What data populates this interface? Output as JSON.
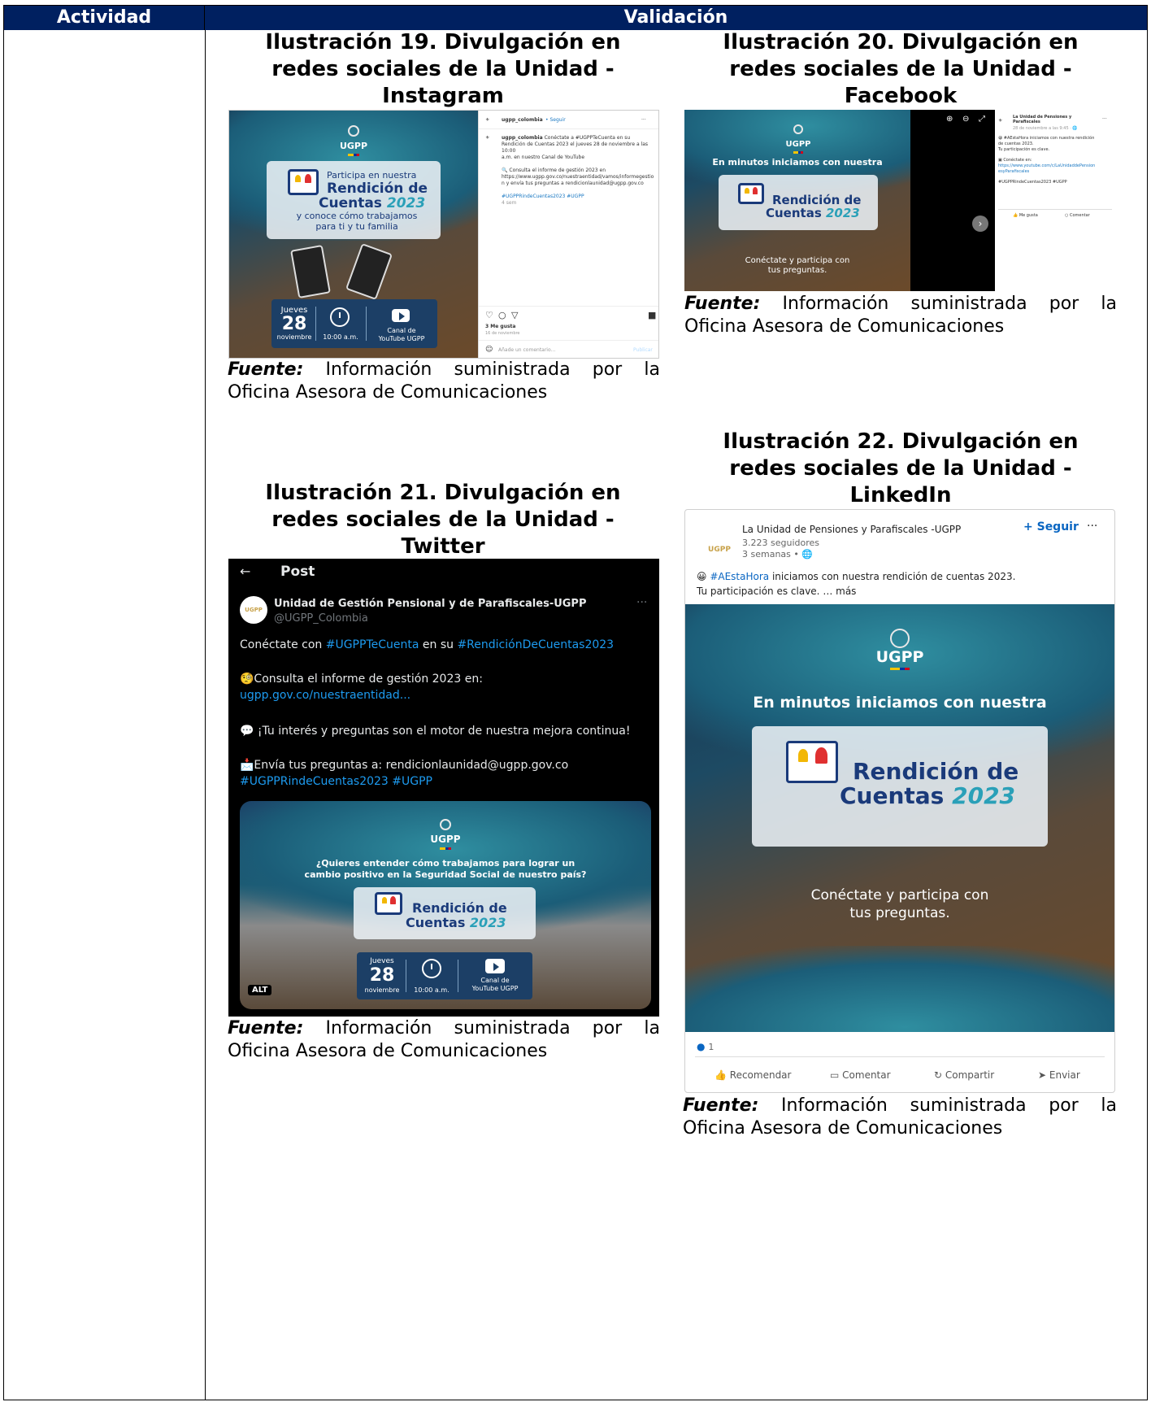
{
  "header": {
    "activity": "Actividad",
    "validation": "Validación"
  },
  "source": {
    "label": "Fuente:",
    "text": "Información suministrada por la Oficina Asesora de Comunicaciones",
    "w1": "Información",
    "w2": "suministrada",
    "w3": "por",
    "w4": "la",
    "line2": "Oficina Asesora de Comunicaciones"
  },
  "figures": [
    {
      "caption_l1": "Ilustración 19. Divulgación en",
      "caption_l2": "redes sociales de la Unidad -",
      "caption_l3": "Instagram"
    },
    {
      "caption_l1": "Ilustración 20. Divulgación en",
      "caption_l2": "redes sociales de la Unidad -",
      "caption_l3": "Facebook"
    },
    {
      "caption_l1": "Ilustración 21. Divulgación en",
      "caption_l2": "redes sociales de la Unidad -",
      "caption_l3": "Twitter"
    },
    {
      "caption_l1": "Ilustración 22. Divulgación en",
      "caption_l2": "redes sociales de la Unidad -",
      "caption_l3": "LinkedIn"
    }
  ],
  "art": {
    "ugpp": "UGPP",
    "participa": "Participa en nuestra",
    "rendicion": "Rendición de",
    "cuentas": "Cuentas",
    "year": "2023",
    "conoce1": "y conoce cómo trabajamos",
    "conoce2": "para ti y tu familia",
    "minutos": "En minutos iniciamos con nuestra",
    "conectate1": "Conéctate y participa con",
    "conectate2": "tus preguntas.",
    "quieres1": "¿Quieres entender cómo trabajamos para lograr un",
    "quieres2": "cambio positivo en la Seguridad Social de nuestro país?",
    "jueves": "Jueves",
    "day": "28",
    "month": "noviembre",
    "time": "10:00 a.m.",
    "canal1": "Canal de",
    "canal2": "YouTube UGPP",
    "alt": "ALT"
  },
  "instagram": {
    "account": "ugpp_colombia",
    "follow": "• Seguir",
    "post1": "Conéctate a #UGPPTeCuenta en su",
    "post2": "Rendición de Cuentas 2023 el jueves 28 de noviembre a las 10:00",
    "post3": "a.m. en nuestro Canal de YouTube",
    "post4": "🔍 Consulta el informe de gestión 2023 en",
    "post5": "https://www.ugpp.gov.co/nuestraentidad/vamos/informegestio",
    "post6": "n y envía tus preguntas a rendicionlaunidad@ugpp.gov.co",
    "tags": "#UGPPRindeCuentas2023 #UGPP",
    "ago": "4 sem",
    "likes": "3 Me gusta",
    "date": "16 de noviembre",
    "comment_ph": "Añade un comentario...",
    "publish": "Publicar"
  },
  "facebook": {
    "page1": "La Unidad de Pensiones y",
    "page2": "Parafiscales",
    "date": "28 de noviembre a las 9:45 · 🌐",
    "post1": "😀 #AEstaHora iniciamos con nuestra rendición",
    "post2": "de cuentas 2023.",
    "post3": "Tu participación es clave.",
    "post4": "▣ Conéctate en:",
    "link1": "https://www.youtube.com/c/LaUnidaddePension",
    "link2": "esyParafiscales",
    "tags": "#UGPPRindeCuentas2023 #UGPP",
    "like": "Me gusta",
    "comment": "Comentar"
  },
  "twitter": {
    "back": "←",
    "title": "Post",
    "name": "Unidad de Gestión Pensional y de Parafiscales-UGPP",
    "handle": "@UGPP_Colombia",
    "more": "···",
    "l1a": "Conéctate con ",
    "l1b": "#UGPPTeCuenta",
    "l1c": " en su ",
    "l1d": "#RendiciónDeCuentas2023",
    "l2": "🧐Consulta el informe de gestión 2023 en:",
    "l3": "ugpp.gov.co/nuestraentidad...",
    "l4": "💬 ¡Tu interés y preguntas son el motor de nuestra mejora continua!",
    "l5": "📩Envía tus preguntas a: rendicionlaunidad@ugpp.gov.co",
    "l6": "#UGPPRindeCuentas2023 #UGPP"
  },
  "linkedin": {
    "org": "La Unidad de Pensiones y Parafiscales -UGPP",
    "followers": "3.223 seguidores",
    "ago": "3 semanas • 🌐",
    "follow": "+ Seguir",
    "more": "···",
    "tag": "#AEstaHora",
    "post1": " iniciamos con nuestra rendición de cuentas 2023.",
    "post2": "Tu participación es clave.  … más",
    "reactions": "1",
    "recommend": "Recomendar",
    "comment": "Comentar",
    "share": "Compartir",
    "send": "Enviar"
  }
}
